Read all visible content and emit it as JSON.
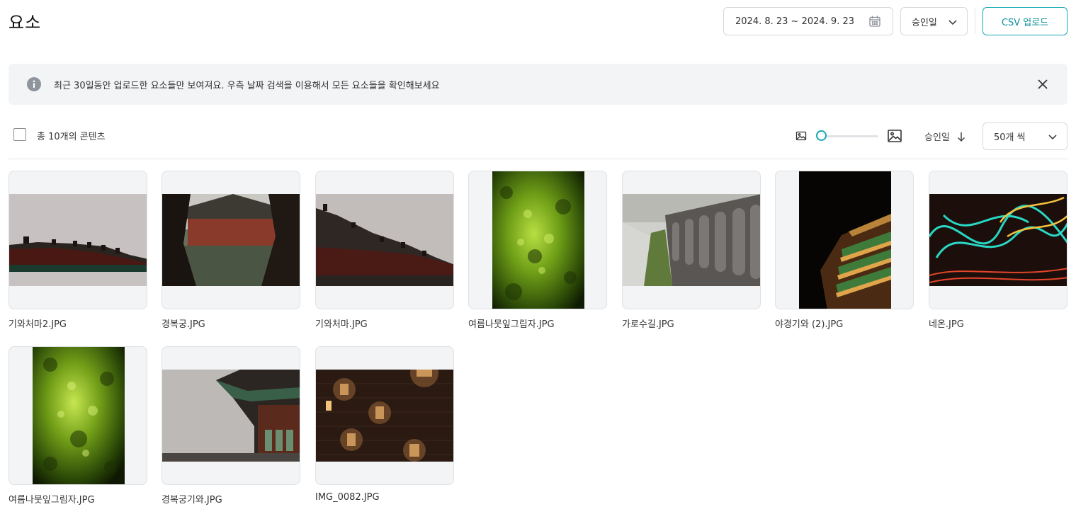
{
  "page": {
    "title": "요소"
  },
  "header": {
    "date_range": "2024. 8. 23 ~ 2024. 9. 23",
    "sort_select": "승인일",
    "csv_button": "CSV 업로드"
  },
  "notice": {
    "message": "최근 30일동안 업로드한 요소들만 보여져요. 우측 날짜 검색을 이용해서 모든 요소들을 확인해보세요"
  },
  "toolbar": {
    "count_label": "총 10개의 콘텐츠",
    "sort_label": "승인일",
    "per_page": "50개 씩",
    "thumbnail_size_level": 0
  },
  "items": [
    {
      "name": "기와처마2.JPG",
      "icon": "roof-eaves-photo"
    },
    {
      "name": "경복궁.JPG",
      "icon": "palace-pond-photo"
    },
    {
      "name": "기와처마.JPG",
      "icon": "roof-eaves-photo"
    },
    {
      "name": "여름나뭇잎그림자.JPG",
      "icon": "green-leaves-photo"
    },
    {
      "name": "가로수길.JPG",
      "icon": "roof-tiles-path-photo"
    },
    {
      "name": "야경기와 (2).JPG",
      "icon": "night-roof-photo"
    },
    {
      "name": "네온.JPG",
      "icon": "neon-light-trails-photo"
    },
    {
      "name": "여름나뭇잎그림자.JPG",
      "icon": "green-leaves-photo"
    },
    {
      "name": "경복궁기와.JPG",
      "icon": "palace-roof-photo"
    },
    {
      "name": "IMG_0082.JPG",
      "icon": "lit-brick-wall-photo"
    }
  ],
  "colors": {
    "accent": "#17a9b3",
    "notice_bg": "#f3f4f6",
    "border": "#d6d8dc"
  }
}
